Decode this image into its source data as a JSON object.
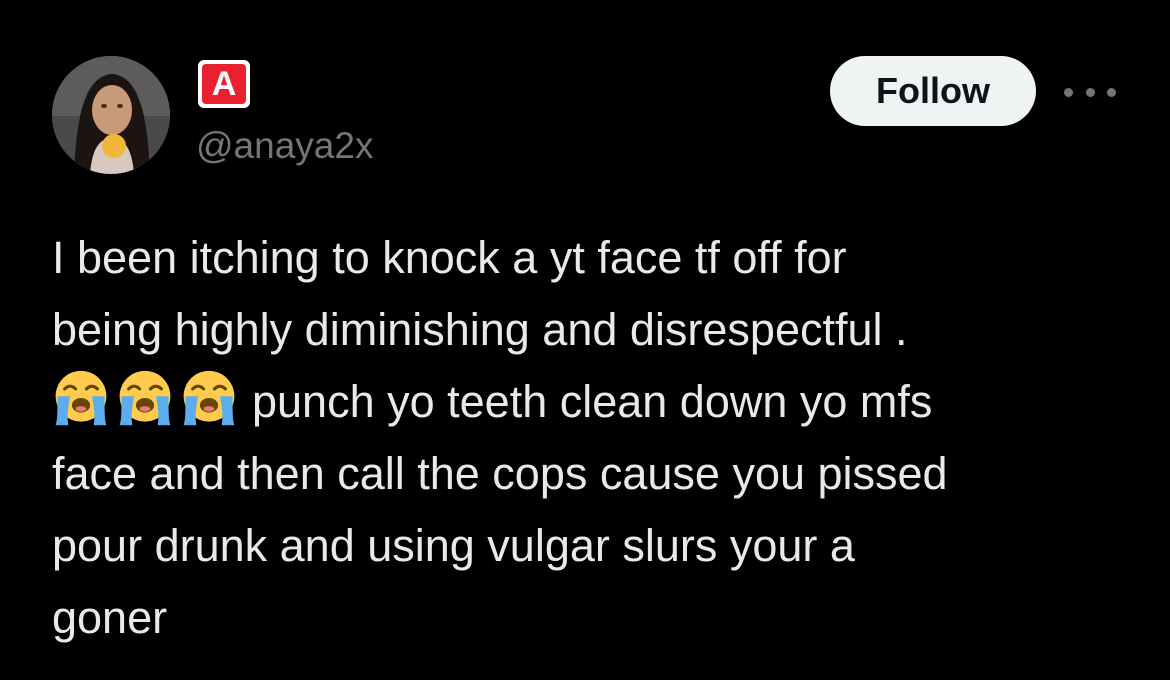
{
  "tweet": {
    "author": {
      "display_name": "A",
      "handle": "@anaya2x",
      "avatar_icon": "profile-photo",
      "badge_color": "#e8202f"
    },
    "follow_label": "Follow",
    "more_icon": "ellipsis-icon",
    "text_lines": [
      "I been itching to knock a yt face tf off for",
      "being highly diminishing and disrespectful .",
      "punch yo teeth clean down yo mfs",
      "face and then call the cops cause you pissed",
      "pour drunk and using vulgar slurs your a",
      "goner"
    ],
    "emojis": [
      "loudly-crying-face-icon",
      "loudly-crying-face-icon",
      "loudly-crying-face-icon"
    ],
    "colors": {
      "background": "#000000",
      "text": "#e7e9ea",
      "secondary": "#71767b",
      "button_bg": "#eff3f4"
    }
  }
}
